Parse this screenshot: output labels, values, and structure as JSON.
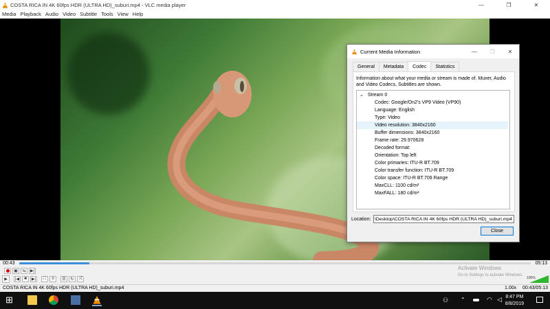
{
  "window": {
    "title": "COSTA RICA IN 4K 60fps HDR (ULTRA HD)_suburi.mp4 - VLC media player",
    "minimize_glyph": "—",
    "restore_glyph": "❐",
    "close_glyph": "✕"
  },
  "menu": [
    "Media",
    "Playback",
    "Audio",
    "Video",
    "Subtitle",
    "Tools",
    "View",
    "Help"
  ],
  "dialog": {
    "title": "Current Media Information",
    "tabs": [
      "General",
      "Metadata",
      "Codec",
      "Statistics"
    ],
    "active_tab": "Codec",
    "description": "Information about what your media or stream is made of. Muxer, Audio and Video Codecs, Subtitles are shown.",
    "stream_label": "Stream 0",
    "stream_toggle": "⌄",
    "fields": [
      "Codec: Google/On2's VP9 Video (VP90)",
      "Language: English",
      "Type: Video",
      "Video resolution: 3840x2160",
      "Buffer dimensions: 3840x2160",
      "Frame rate: 29.970628",
      "Decoded format:",
      "Orientation: Top left",
      "Color primaries: ITU-R BT.709",
      "Color transfer function: ITU-R BT.709",
      "Color space: ITU-R BT.709 Range",
      "MaxCLL: 1100 cd/m²",
      "MaxFALL: 180 cd/m²"
    ],
    "location_label": "Location:",
    "location_value": "\\Desktop\\COSTA RICA IN 4K 60fps HDR (ULTRA HD)_suburi.mp4",
    "close_label": "Close"
  },
  "player": {
    "elapsed": "00:43",
    "total": "05:13",
    "progress": 0.137,
    "filename": "COSTA RICA IN 4K 60fps HDR (ULTRA HD)_suburi.mp4",
    "speed": "1.00x",
    "position": "00:43/05:13",
    "volume_percent": "100%"
  },
  "watermark": {
    "line1": "Activate Windows",
    "line2": "Go to Settings to activate Windows."
  },
  "taskbar": {
    "time": "8:47 PM",
    "date": "8/8/2019",
    "start_glyph": "⊞",
    "tray_glyphs": [
      "⌃"
    ]
  },
  "colors": {
    "accent": "#3b8fd8",
    "vlc_orange": "#f08c00",
    "taskbar": "#101010"
  }
}
